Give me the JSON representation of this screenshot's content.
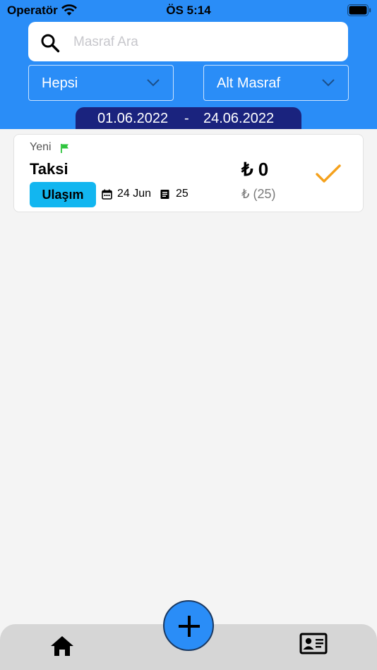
{
  "status_bar": {
    "carrier": "Operatör",
    "time": "ÖS 5:14"
  },
  "search": {
    "placeholder": "Masraf Ara",
    "value": ""
  },
  "filters": {
    "category": "Hepsi",
    "sub_category": "Alt Masraf"
  },
  "date_range": {
    "from": "01.06.2022",
    "separator": "-",
    "to": "24.06.2022"
  },
  "expenses": [
    {
      "status": "Yeni",
      "title": "Taksi",
      "category": "Ulaşım",
      "date": "24 Jun",
      "doc_count": "25",
      "amount": "₺ 0",
      "sub_amount": "₺ (25)"
    }
  ],
  "colors": {
    "header": "#2a8df7",
    "date_pill": "#1a237e",
    "badge": "#12b6f0",
    "check": "#f5a11c",
    "flag": "#2ec43d",
    "bottom_bar": "#d6d6d6"
  },
  "icons": [
    "wifi-icon",
    "battery-icon",
    "search-icon",
    "chevron-down-icon",
    "flag-icon",
    "calendar-icon",
    "document-icon",
    "check-icon",
    "add-icon",
    "home-icon",
    "contact-card-icon"
  ]
}
